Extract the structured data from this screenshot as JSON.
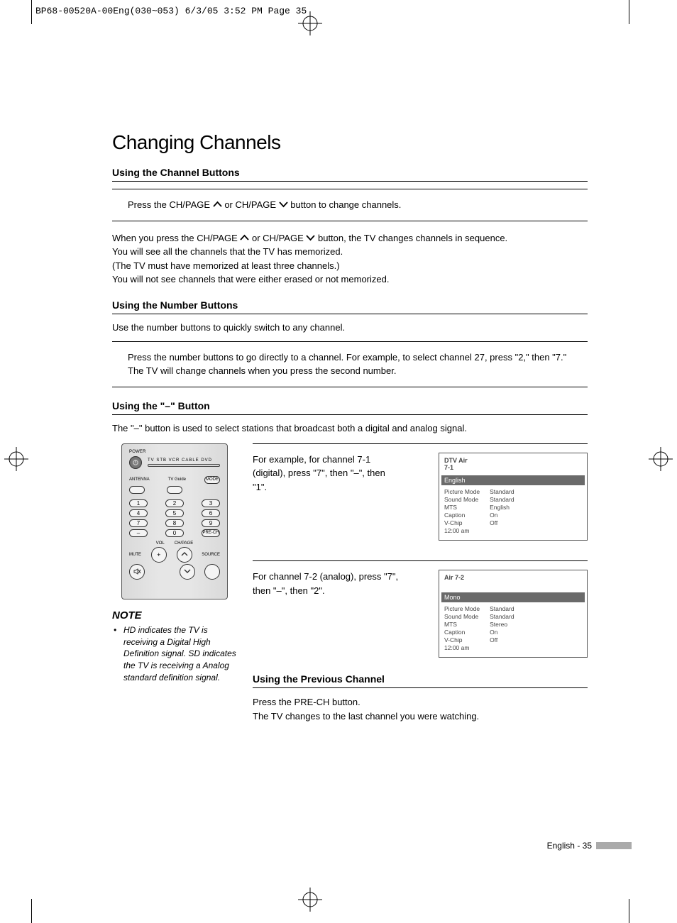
{
  "slug": "BP68-00520A-00Eng(030~053)  6/3/05  3:52 PM  Page 35",
  "title": "Changing Channels",
  "s1": {
    "heading": "Using the Channel Buttons",
    "box_a": "Press the CH/PAGE ",
    "box_b": " or CH/PAGE ",
    "box_c": " button to change channels.",
    "p1a": "When you press the CH/PAGE ",
    "p1b": " or CH/PAGE ",
    "p1c": " button, the TV changes channels in sequence.",
    "p2": "You will see all the channels that the TV has memorized.",
    "p3": "(The TV must have memorized at least three channels.)",
    "p4": "You will not see channels that were either erased or not memorized."
  },
  "s2": {
    "heading": "Using the Number Buttons",
    "intro": "Use the number buttons to quickly switch to any channel.",
    "box": "Press the number buttons to go directly to a channel. For example, to select channel 27, press \"2,\" then \"7.\" The TV will change channels when you press the second number."
  },
  "s3": {
    "heading": "Using the \"–\" Button",
    "intro": "The \"–\" button is used to select stations that broadcast both a digital and analog signal.",
    "ex1": "For example, for channel 7-1 (digital), press \"7\", then \"–\", then \"1\".",
    "ex2": "For channel 7-2 (analog), press \"7\", then \"–\", then \"2\"."
  },
  "osd1": {
    "line1": "DTV Air",
    "line2": "7-1",
    "bar": "English",
    "l1": "Picture Mode",
    "v1": "Standard",
    "l2": "Sound Mode",
    "v2": "Standard",
    "l3": "MTS",
    "v3": "English",
    "l4": "Caption",
    "v4": "On",
    "l5": "V-Chip",
    "v5": "Off",
    "l6": "12:00 am"
  },
  "osd2": {
    "line1": "Air 7-2",
    "bar": "Mono",
    "l1": "Picture Mode",
    "v1": "Standard",
    "l2": "Sound Mode",
    "v2": "Standard",
    "l3": "MTS",
    "v3": "Stereo",
    "l4": "Caption",
    "v4": "On",
    "l5": "V-Chip",
    "v5": "Off",
    "l6": "12:00 am"
  },
  "note": {
    "heading": "NOTE",
    "item": "HD indicates the TV is receiving a Digital High Definition signal. SD indicates the TV is receiving a Analog standard definition signal."
  },
  "s4": {
    "heading": "Using the Previous Channel",
    "p1": "Press the PRE-CH button.",
    "p2": "The TV changes to the last channel you were watching."
  },
  "remote": {
    "power": "POWER",
    "devices": "TV   STB   VCR  CABLE  DVD",
    "antenna": "ANTENNA",
    "tvguide": "TV Guide",
    "mode": "MODE",
    "n1": "1",
    "n2": "2",
    "n3": "3",
    "n4": "4",
    "n5": "5",
    "n6": "6",
    "n7": "7",
    "n8": "8",
    "n9": "9",
    "dash": "–",
    "n0": "0",
    "prech": "PRE-CH",
    "vol": "VOL",
    "chpage": "CH/PAGE",
    "mute": "MUTE",
    "source": "SOURCE"
  },
  "footer": "English - 35"
}
